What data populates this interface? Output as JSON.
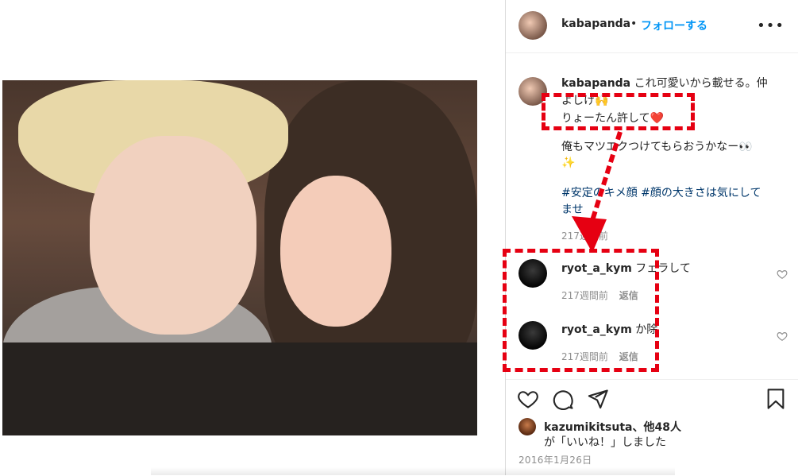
{
  "post": {
    "username": "kabapanda",
    "separator": "•",
    "follow_label": "フォローする",
    "more_label": "•••"
  },
  "caption": {
    "username": "kabapanda",
    "line1": "これ可愛いから載せる。仲",
    "line2": "よしけ🙌",
    "line3": "りょーたん許して❤️",
    "line4": "俺もマツエクつけてもらおうかなー👀",
    "line5": "✨",
    "hashtags_line1": "#安定のキメ顔 #顔の大きさは気にして",
    "hashtags_line2": "ませ",
    "time": "217週間前"
  },
  "comments": [
    {
      "username": "ryot_a_kym",
      "text": "フェラして",
      "time": "217週間前",
      "reply_label": "返信"
    },
    {
      "username": "ryot_a_kym",
      "text": "か除",
      "time": "217週間前",
      "reply_label": "返信"
    }
  ],
  "likes": {
    "line1_user": "kazumikitsuta",
    "line1_rest": "、他48人",
    "line2": "が「いいね！」しました"
  },
  "date": "2016年1月26日",
  "icons": {
    "heart": "heart-icon",
    "comment": "comment-icon",
    "share": "share-icon",
    "bookmark": "bookmark-icon",
    "more": "more-icon"
  },
  "colors": {
    "accent": "#0095f6",
    "annotation_red": "#e60012",
    "meta_gray": "#8e8e8e",
    "hashtag": "#00376b"
  }
}
